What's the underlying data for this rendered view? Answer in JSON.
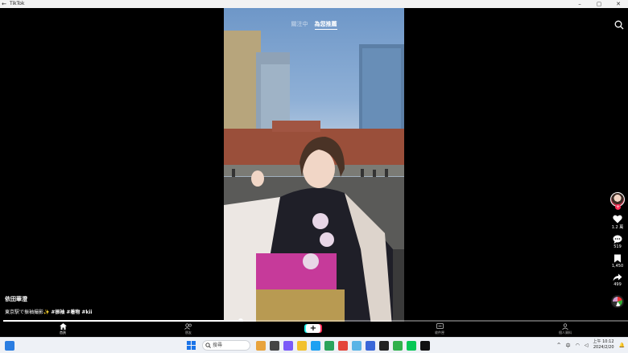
{
  "window": {
    "title": "TikTok"
  },
  "feed_tabs": [
    {
      "label": "關注中",
      "active": false
    },
    {
      "label": "為您推薦",
      "active": true
    }
  ],
  "video": {
    "author": "依田華澄",
    "description": "東京駅で振袖撮影✨",
    "hashtags": [
      "#振袖",
      "#着物",
      "#kii"
    ],
    "progress": 0.38
  },
  "rail": {
    "likes": "1.2 萬",
    "comments": "519",
    "bookmarks": "1,450",
    "shares": "499"
  },
  "bottom_nav": [
    {
      "label": "首頁",
      "icon": "home-icon",
      "active": true
    },
    {
      "label": "朋友",
      "icon": "friends-icon",
      "active": false
    },
    {
      "label": "收件匣",
      "icon": "inbox-icon",
      "active": false
    },
    {
      "label": "個人資料",
      "icon": "profile-icon",
      "active": false
    }
  ],
  "taskbar": {
    "search_placeholder": "搜尋",
    "ime": "中",
    "time_period": "上午",
    "time": "10:12",
    "date": "2024/2/20"
  },
  "colors": {
    "accent": "#fe2c55",
    "accent2": "#25f4ee",
    "bg": "#000000"
  }
}
